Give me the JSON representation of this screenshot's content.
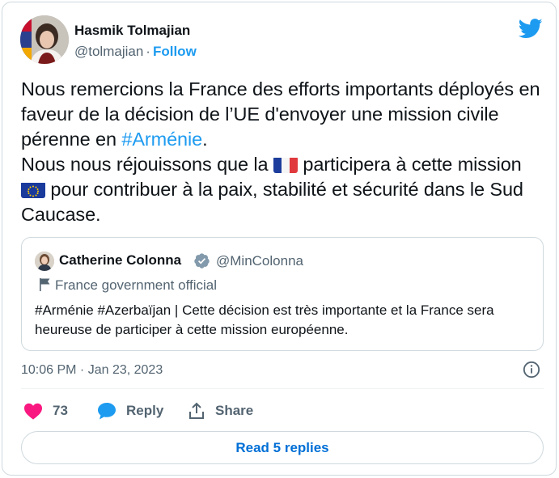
{
  "author": {
    "name": "Hasmik Tolmajian",
    "handle": "@tolmajian",
    "separator": "·",
    "follow_label": "Follow"
  },
  "tweet": {
    "line1": "Nous remercions la France des efforts importants déployés en faveur de la décision de l’UE d'envoyer une mission civile pérenne en ",
    "hashtag": "#Arménie",
    "line1_end": ".",
    "line2a": "Nous nous réjouissons que la ",
    "line2b": " participera à cette mission ",
    "line2c": " pour contribuer à la paix, stabilité et sécurité dans le Sud Caucase.",
    "flag1_icon": "france-flag-icon",
    "flag2_icon": "eu-flag-icon"
  },
  "quote": {
    "name": "Catherine Colonna",
    "handle": "@MinColonna",
    "label": "France government official",
    "text": "#Arménie #Azerbaïjan | Cette décision est très importante et la France sera heureuse de participer à cette mission européenne."
  },
  "meta": {
    "timestamp": "10:06 PM · Jan 23, 2023"
  },
  "actions": {
    "likes": "73",
    "reply_label": "Reply",
    "share_label": "Share"
  },
  "read_replies_label": "Read 5 replies",
  "colors": {
    "accent": "#1d9bf0",
    "like": "#f91880",
    "muted": "#536471",
    "border": "#cfd9de"
  }
}
